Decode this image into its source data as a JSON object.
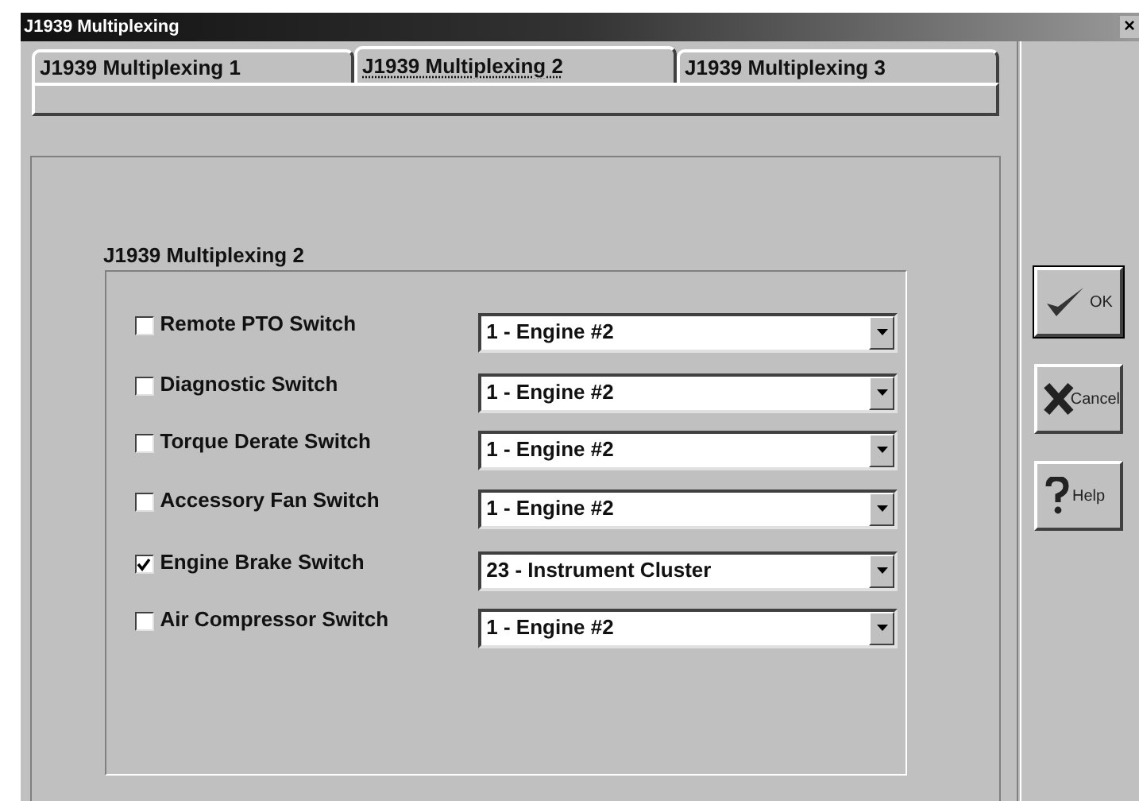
{
  "window": {
    "title": "J1939 Multiplexing",
    "close": "×"
  },
  "tabs": [
    {
      "label": "J1939 Multiplexing 1",
      "selected": false
    },
    {
      "label": "J1939 Multiplexing 2",
      "selected": true
    },
    {
      "label": "J1939 Multiplexing 3",
      "selected": false
    }
  ],
  "group": {
    "title": "J1939 Multiplexing 2"
  },
  "rows": [
    {
      "label": "Remote PTO Switch",
      "checked": false,
      "value": "1 - Engine #2"
    },
    {
      "label": "Diagnostic Switch",
      "checked": false,
      "value": "1 - Engine #2"
    },
    {
      "label": "Torque Derate Switch",
      "checked": false,
      "value": "1 - Engine #2"
    },
    {
      "label": "Accessory Fan Switch",
      "checked": false,
      "value": "1 - Engine #2"
    },
    {
      "label": "Engine Brake Switch",
      "checked": true,
      "value": "23 - Instrument Cluster"
    },
    {
      "label": "Air Compressor Switch",
      "checked": false,
      "value": "1 - Engine #2"
    }
  ],
  "buttons": [
    {
      "kind": "ok",
      "label": "OK"
    },
    {
      "kind": "cancel",
      "label": "Cancel"
    },
    {
      "kind": "help",
      "label": "Help"
    }
  ]
}
